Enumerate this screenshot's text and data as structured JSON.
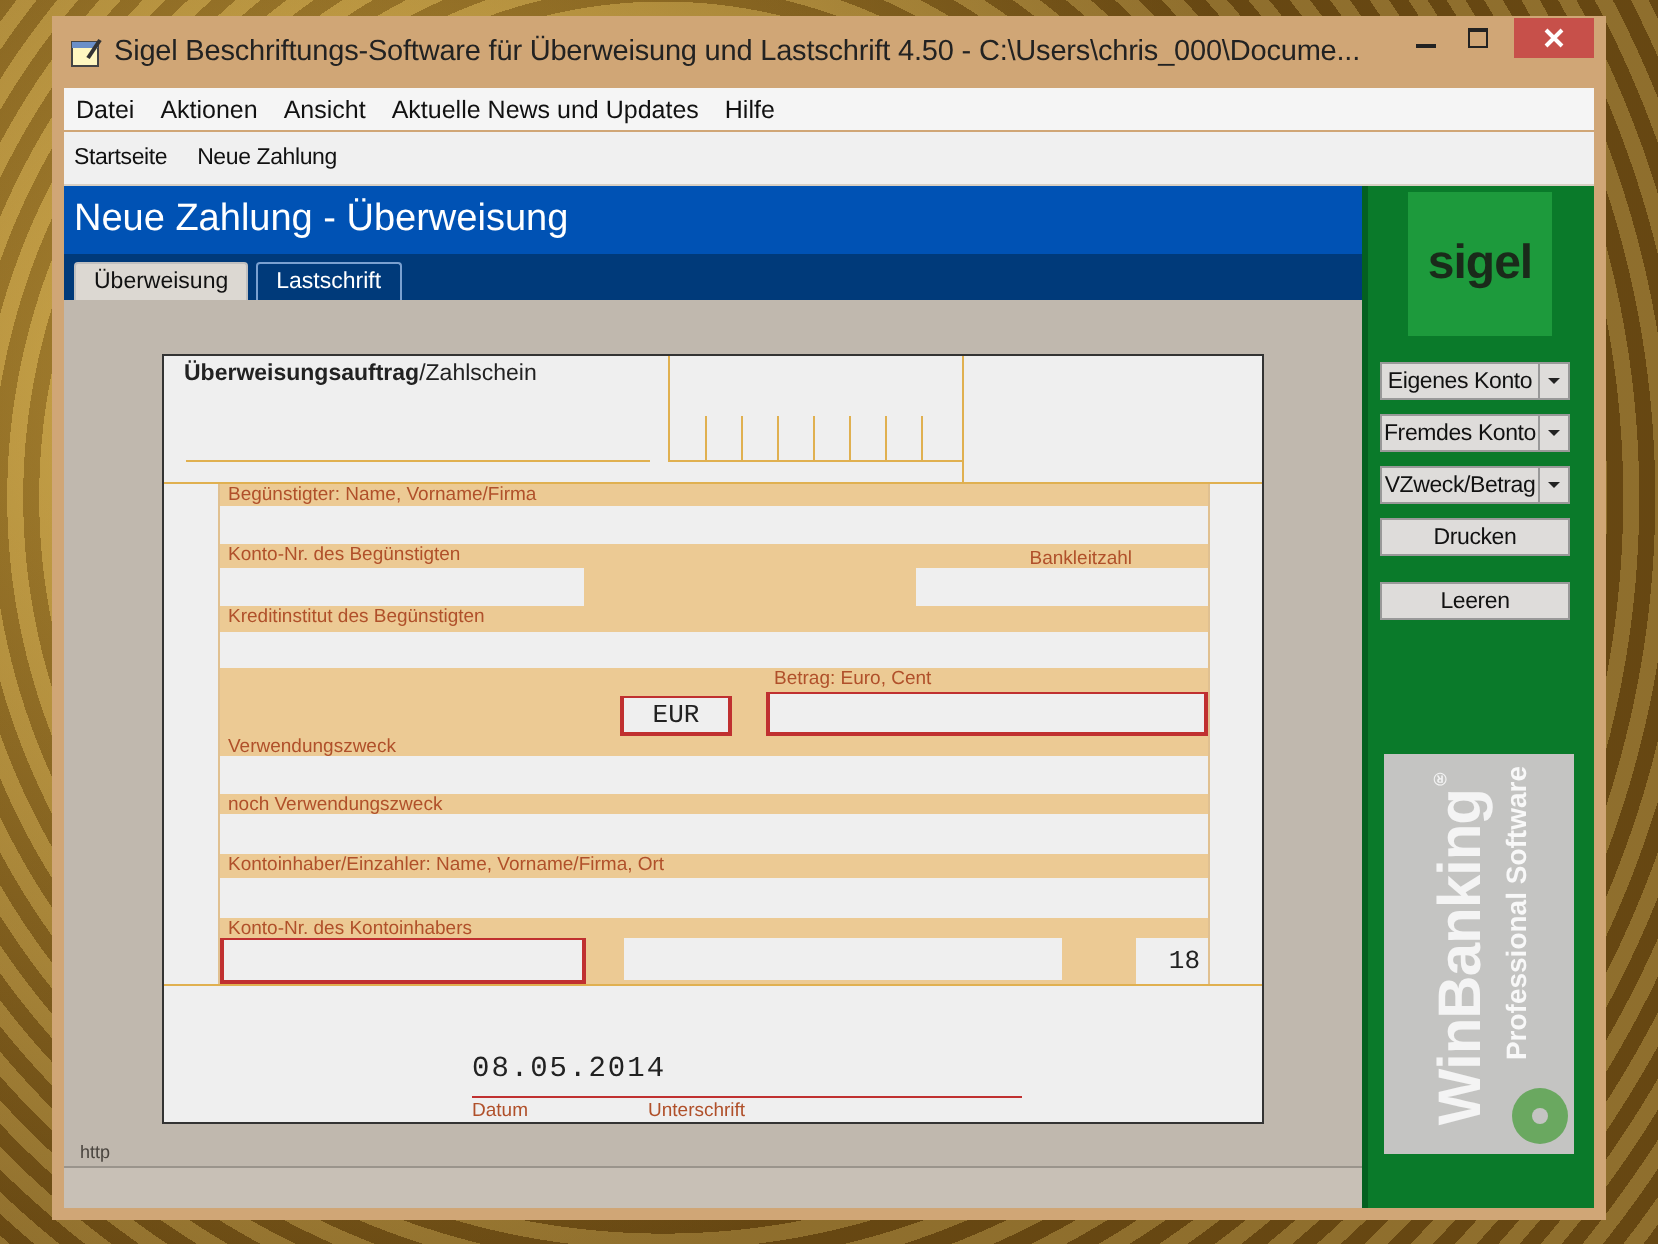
{
  "window": {
    "title": "Sigel Beschriftungs-Software für Überweisung und Lastschrift 4.50 - C:\\Users\\chris_000\\Docume..."
  },
  "menu": [
    "Datei",
    "Aktionen",
    "Ansicht",
    "Aktuelle News und Updates",
    "Hilfe"
  ],
  "toolbar": [
    "Startseite",
    "Neue Zahlung"
  ],
  "header": {
    "title": "Neue Zahlung - Überweisung"
  },
  "tabs": [
    {
      "label": "Überweisung",
      "selected": true
    },
    {
      "label": "Lastschrift",
      "selected": false
    }
  ],
  "form": {
    "title": "**Überweisungsauftrag**/Zahlschein",
    "beneficiary_label": "Begünstigter: Name, Vorname/Firma",
    "account_label": "Konto-Nr. des Begünstigten",
    "bank_code_label": "Bankleitzahl",
    "bank_label": "Kreditinstitut des Begünstigten",
    "amount_label": "Betrag: Euro, Cent",
    "currency": "EUR",
    "purpose_label": "Verwendungszweck",
    "purpose2_label": "noch Verwendungszweck",
    "payer_label": "Kontoinhaber/Einzahler: Name, Vorname/Firma, Ort",
    "payer_account_label": "Konto-Nr. des Kontoinhabers",
    "check_digits": "18",
    "date": "08.05.2014",
    "date_label": "Datum",
    "signature_label": "Unterschrift"
  },
  "status_bar": {
    "text": "http"
  },
  "sidebar": {
    "logo": "sigel",
    "buttons": [
      {
        "label": "Eigenes Konto",
        "kind": "dropdown"
      },
      {
        "label": "Fremdes Konto",
        "kind": "dropdown"
      },
      {
        "label": "VZweck/Betrag",
        "kind": "dropdown"
      },
      {
        "label": "Drucken",
        "kind": "push"
      },
      {
        "label": "Leeren",
        "kind": "push"
      }
    ],
    "banner": {
      "title": "WinBanking$^{®}$",
      "subtitle": "Professional Software"
    }
  }
}
